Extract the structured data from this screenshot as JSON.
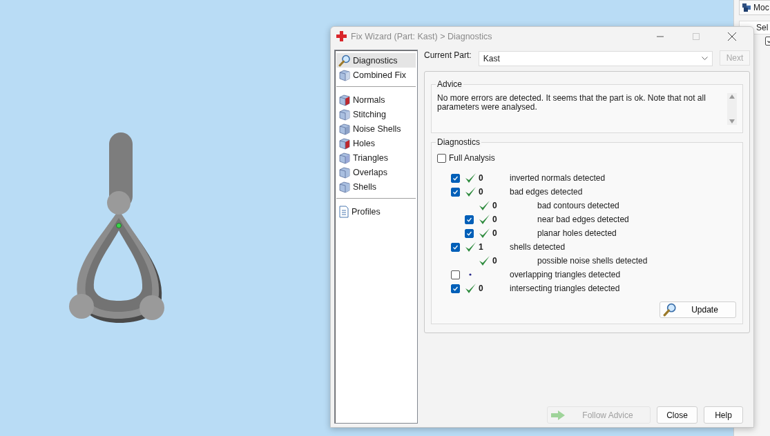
{
  "window": {
    "title": "Fix Wizard (Part: Kast) > Diagnostics"
  },
  "sidebar": {
    "groups": [
      [
        {
          "label": "Diagnostics",
          "selected": true
        },
        {
          "label": "Combined Fix",
          "selected": false
        }
      ],
      [
        {
          "label": "Normals",
          "selected": false
        },
        {
          "label": "Stitching",
          "selected": false
        },
        {
          "label": "Noise Shells",
          "selected": false
        },
        {
          "label": "Holes",
          "selected": false
        },
        {
          "label": "Triangles",
          "selected": false
        },
        {
          "label": "Overlaps",
          "selected": false
        },
        {
          "label": "Shells",
          "selected": false
        }
      ],
      [
        {
          "label": "Profiles",
          "selected": false
        }
      ]
    ]
  },
  "current_part": {
    "label": "Current Part:",
    "value": "Kast"
  },
  "next_button": {
    "label": "Next",
    "disabled": true
  },
  "advice": {
    "title": "Advice",
    "text": "No more errors are detected. It seems that the part is ok. Note that not all parameters were analysed."
  },
  "diagnostics": {
    "title": "Diagnostics",
    "full_analysis": {
      "label": "Full Analysis",
      "checked": false
    },
    "rows": [
      {
        "checked": true,
        "ok": true,
        "count": "0",
        "label": "inverted normals detected"
      },
      {
        "checked": true,
        "ok": true,
        "count": "0",
        "label": "bad edges detected",
        "children": [
          {
            "ok": true,
            "count": "0",
            "label": "bad contours detected"
          },
          {
            "checked": true,
            "ok": true,
            "count": "0",
            "label": "near bad edges detected"
          },
          {
            "checked": true,
            "ok": true,
            "count": "0",
            "label": "planar holes detected"
          }
        ]
      },
      {
        "checked": true,
        "ok": true,
        "count": "1",
        "label": "shells detected",
        "children": [
          {
            "ok": true,
            "count": "0",
            "label": "possible noise shells detected"
          }
        ]
      },
      {
        "checked": false,
        "ok": false,
        "label": "overlapping triangles detected"
      },
      {
        "checked": true,
        "ok": true,
        "count": "0",
        "label": "intersecting triangles detected"
      }
    ],
    "update_button": "Update"
  },
  "buttons": [
    {
      "label": "Follow Advice",
      "disabled": true
    },
    {
      "label": "Close",
      "disabled": false
    },
    {
      "label": "Help",
      "disabled": false
    }
  ],
  "side_panel": {
    "button": "Moc",
    "column_1": "Sel",
    "checked": true
  }
}
